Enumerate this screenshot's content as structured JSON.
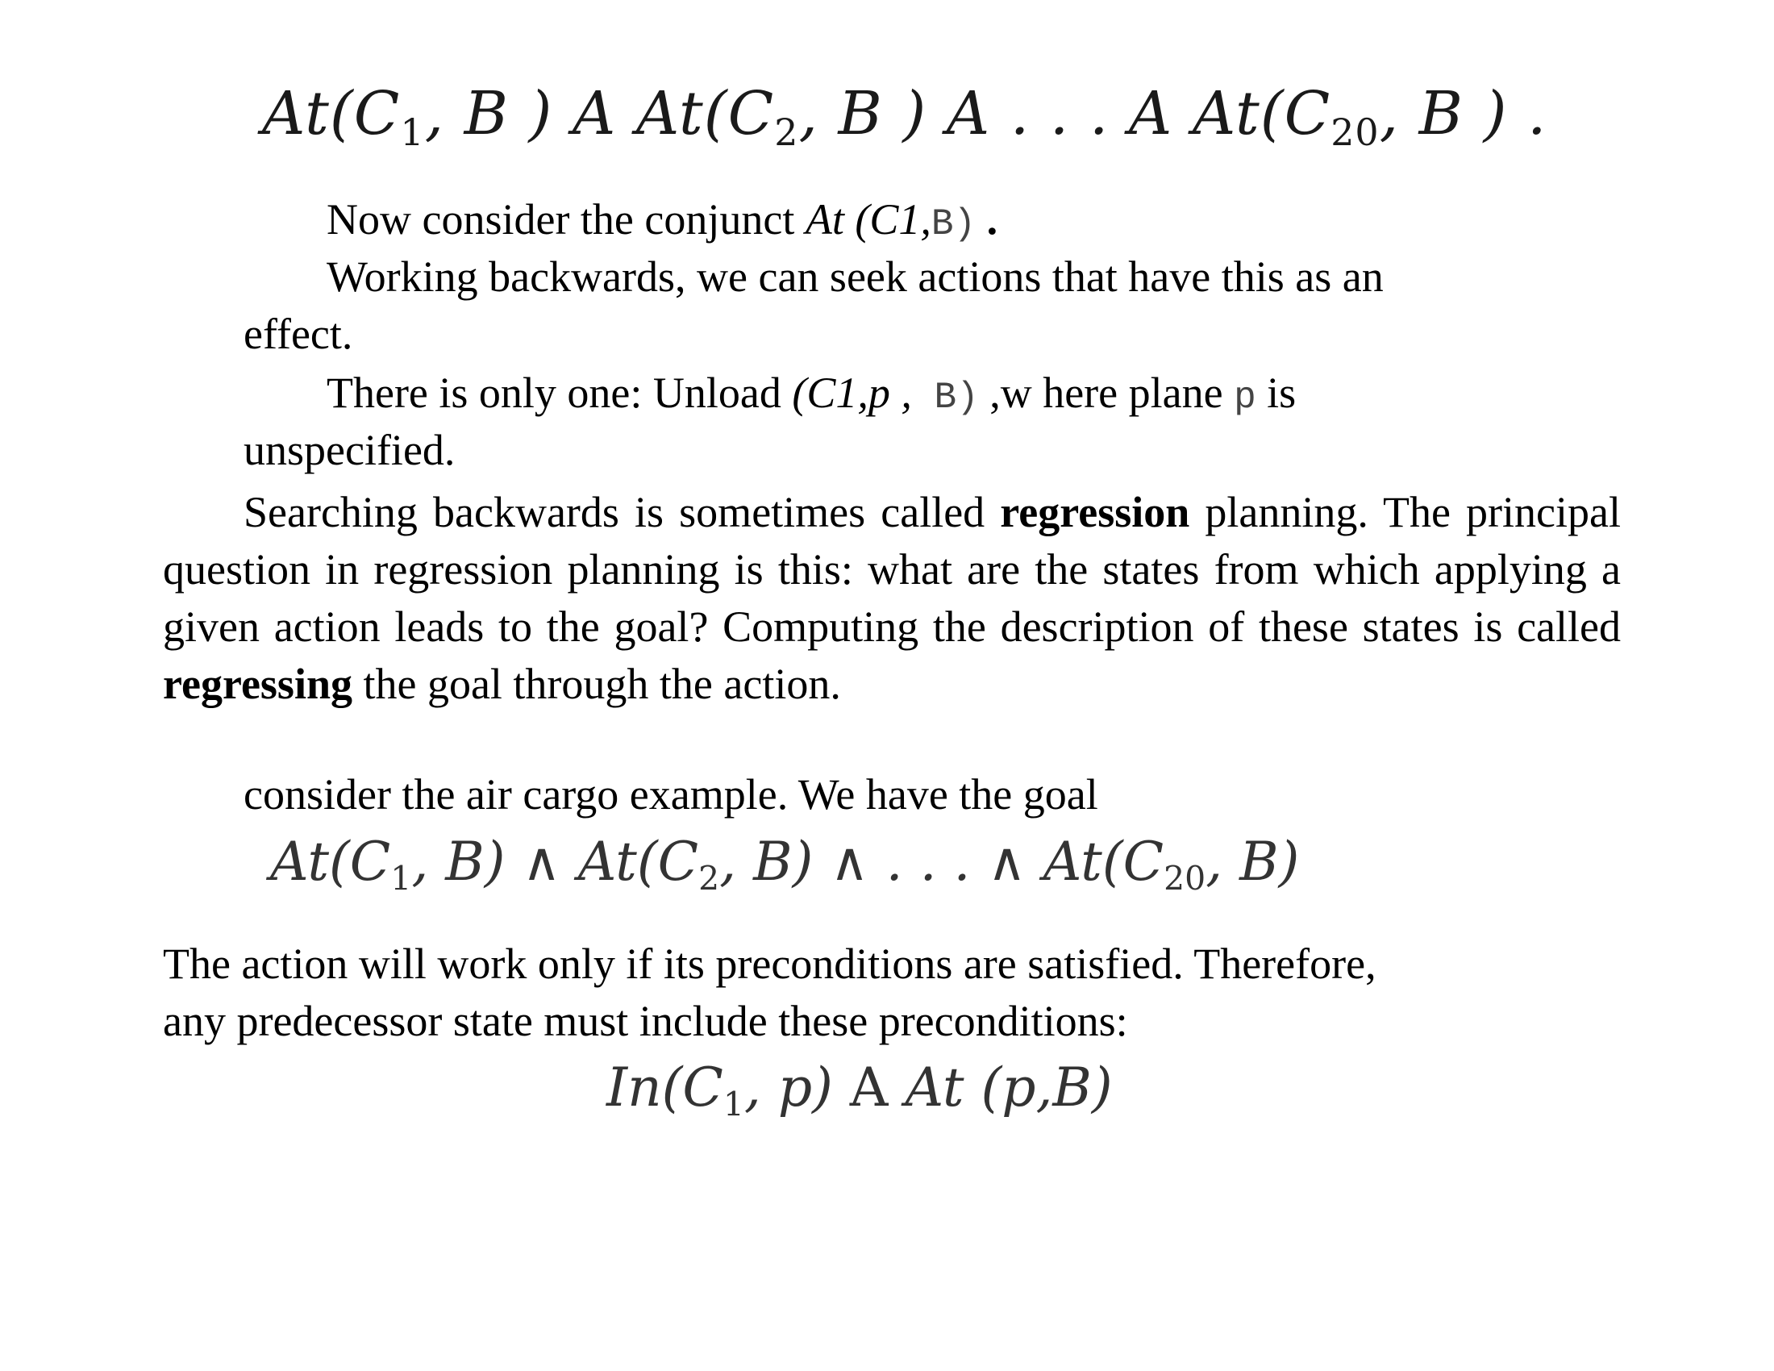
{
  "formula_1": {
    "pre": "At(C",
    "sub1": "1",
    "mid1": ", B ) ",
    "and1": "A",
    "mid2": " At(C",
    "sub2": "2",
    "mid3": ", B ) ",
    "and2": "A",
    "mid4": " . . . ",
    "and3": "A",
    "mid5": " At(C",
    "sub3": "20",
    "end": ", B ) ."
  },
  "para_consider": {
    "text": "Now consider the conjunct ",
    "italic": "At (C1,",
    "mono": "B)",
    "end": " ."
  },
  "para_working": {
    "line1": "Working backwards, we can seek actions that have this as an",
    "line2": "effect."
  },
  "para_only_one": {
    "text": "There is only one: Unload ",
    "italic": "(C1,p ,",
    "mono": " B)",
    "end1": " ,w here plane ",
    "mono_p": "p",
    "end2": "  is",
    "line2": "unspecified."
  },
  "para_regression": {
    "t1": "Searching backwards is sometimes called ",
    "b1": "regression",
    "t2": " planning. The principal question in regression planning is this: what are the states from which applying a given action leads to the goal? Computing the description of these states is called ",
    "b2": "regressing",
    "t3": " the goal through the action."
  },
  "para_air_cargo": "consider the air cargo example. We have the goal",
  "formula_2": {
    "pre": "At(C",
    "sub1": "1",
    "mid1": ", B) ",
    "and1": "∧",
    "mid2": " At(C",
    "sub2": "2",
    "mid3": ", B) ",
    "and2": "∧",
    "mid4": " . . . ",
    "and3": "∧",
    "mid5": " At(C",
    "sub3": "20",
    "end": ", B)"
  },
  "para_action": {
    "line1": "The action will work only if its preconditions are satisfied. Therefore,",
    "line2": "any predecessor state must include these preconditions:"
  },
  "formula_3": {
    "pre": "In(C",
    "sub1": "1",
    "mid1": ", p) ",
    "and1": "A",
    "end": " At (p,B)"
  }
}
